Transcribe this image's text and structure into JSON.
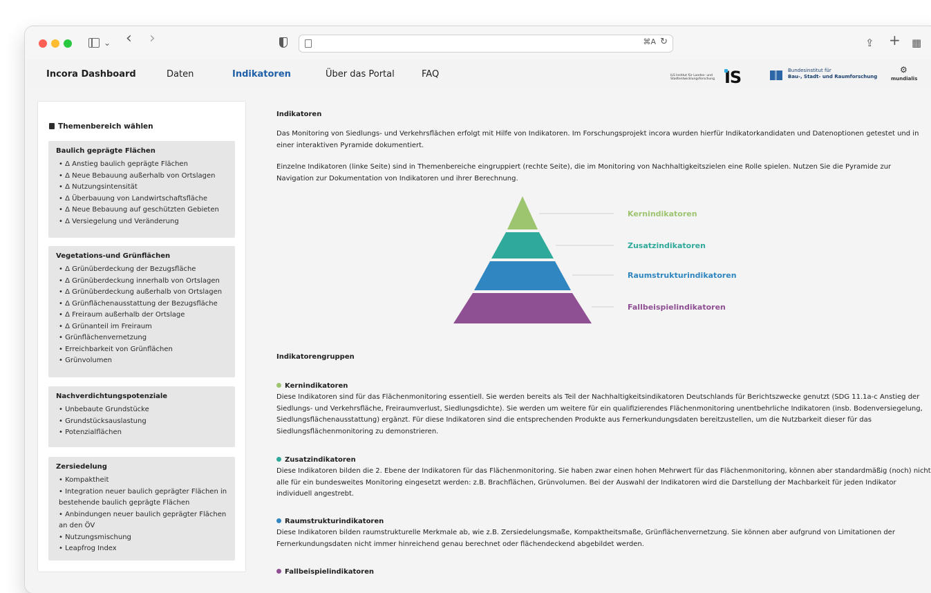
{
  "browser": {
    "icons": [
      "sidebar-icon",
      "chevron-down-icon",
      "back-icon",
      "forward-icon",
      "shield-icon",
      "page-icon",
      "translate-icon",
      "reload-icon",
      "share-icon",
      "new-tab-icon",
      "tab-overview-icon"
    ],
    "glyphs": {
      "chevron": "⌄",
      "back": "‹",
      "forward": "›",
      "translate": "⌘A",
      "reload": "↻",
      "share": "⇪",
      "plus": "+",
      "tabs": "▦"
    }
  },
  "nav": {
    "brand": "Incora Dashboard",
    "items": [
      "Daten",
      "Indikatoren",
      "Über das Portal",
      "FAQ"
    ],
    "active": "Indikatoren"
  },
  "logos": {
    "ils_text": "ILS Institut für Landes- und Stadtentwicklungsforschung",
    "ils_mark": "IS",
    "bbsr_line1": "Bundesinstitut für",
    "bbsr_line2": "Bau-, Stadt- und Raumforschung",
    "mundialis_mark": "⚙",
    "mundialis": "mundialis"
  },
  "sidebar": {
    "title": "Themenbereich wählen",
    "groups": [
      {
        "title": "Baulich geprägte Flächen",
        "items": [
          "Δ Anstieg baulich geprägte Flächen",
          "Δ Neue Bebauung außerhalb von Ortslagen",
          "Δ Nutzungsintensität",
          "Δ Überbauung von Landwirtschaftsfläche",
          "Δ Neue Bebauung auf geschützten Gebieten",
          "Δ Versiegelung und Veränderung"
        ]
      },
      {
        "title": "Vegetations-und Grünflächen",
        "items": [
          "Δ Grünüberdeckung der Bezugsfläche",
          "Δ Grünüberdeckung innerhalb von Ortslagen",
          "Δ Grünüberdeckung außerhalb von Ortslagen",
          "Δ Grünflächenausstattung der Bezugsfläche",
          "Δ Freiraum außerhalb der Ortslage",
          "Δ Grünanteil im Freiraum",
          "Grünflächenvernetzung",
          "Erreichbarkeit von Grünflächen",
          "Grünvolumen"
        ]
      },
      {
        "title": "Nachverdichtungspotenziale",
        "items": [
          "Unbebaute Grundstücke",
          "Grundstücksauslastung",
          "Potenzialflächen"
        ]
      },
      {
        "title": "Zersiedelung",
        "items": [
          "Kompaktheit",
          "Integration neuer baulich geprägter Flächen in bestehende baulich geprägte Flächen",
          "Anbindungen neuer baulich geprägter Flächen an den ÖV",
          "Nutzungsmischung",
          "Leapfrog Index"
        ]
      }
    ]
  },
  "main": {
    "heading": "Indikatoren",
    "p1": "Das Monitoring von Siedlungs- und Verkehrsflächen erfolgt mit Hilfe von Indikatoren. Im Forschungsprojekt incora wurden hierfür Indikatorkandidaten und Datenoptionen getestet und in einer interaktiven Pyramide dokumentiert.",
    "p2": "Einzelne Indikatoren (linke Seite) sind in Themenbereiche eingruppiert (rechte Seite), die im Monitoring von Nachhaltigkeitszielen eine Rolle spielen. Nutzen Sie die Pyramide zur Navigation zur Dokumentation von Indikatoren und ihrer Berechnung.",
    "pyramid": [
      {
        "label": "Kernindikatoren",
        "color": "#9dc46e"
      },
      {
        "label": "Zusatzindikatoren",
        "color": "#2fa99a"
      },
      {
        "label": "Raumstrukturindikatoren",
        "color": "#2f86c0"
      },
      {
        "label": "Fallbeispielindikatoren",
        "color": "#8f4f93"
      }
    ],
    "groups_heading": "Indikatorengruppen",
    "groups": [
      {
        "title": "Kernindikatoren",
        "color": "#9dc46e",
        "text": "Diese Indikatoren sind für das Flächenmonitoring essentiell. Sie werden bereits als Teil der Nachhaltigkeitsindikatoren Deutschlands für Berichtszwecke genutzt (SDG 11.1a-c Anstieg der Siedlungs- und Verkehrsfläche, Freiraumverlust, Siedlungsdichte). Sie werden um weitere für ein qualifizierendes Flächenmonitoring unentbehrliche Indikatoren (insb. Bodenversiegelung, Siedlungsflächenausstattung) ergänzt. Für diese Indikatoren sind die entsprechenden Produkte aus Fernerkundungsdaten bereitzustellen, um die Nutzbarkeit dieser für das Siedlungsflächenmonitoring zu demonstrieren."
      },
      {
        "title": "Zusatzindikatoren",
        "color": "#2fa99a",
        "text": "Diese Indikatoren bilden die 2. Ebene der Indikatoren für das Flächenmonitoring. Sie haben zwar einen hohen Mehrwert für das Flächenmonitoring, können aber standardmäßig (noch) nicht alle für ein bundesweites Monitoring eingesetzt werden: z.B. Brachflächen, Grünvolumen. Bei der Auswahl der Indikatoren wird die Darstellung der Machbarkeit für jeden Indikator individuell angestrebt."
      },
      {
        "title": "Raumstrukturindikatoren",
        "color": "#2f86c0",
        "text": "Diese Indikatoren bilden raumstrukturelle Merkmale ab, wie z.B. Zersiedelungsmaße, Kompaktheitsmaße, Grünflächenvernetzung. Sie können aber aufgrund von Limitationen der Fernerkundungsdaten nicht immer hinreichend genau berechnet oder flächendeckend abgebildet werden."
      },
      {
        "title": "Fallbeispielindikatoren",
        "color": "#8f4f93",
        "text": ""
      }
    ]
  }
}
